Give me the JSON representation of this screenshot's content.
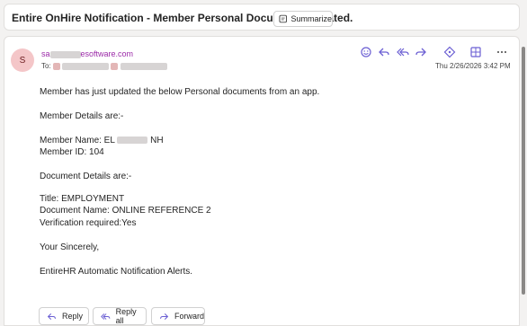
{
  "subject": "Entire OnHire Notification - Member Personal Documents updated.",
  "summarize_label": "Summarize",
  "sender": {
    "initial": "S",
    "email_prefix": "sa",
    "email_suffix": "esoftware.com"
  },
  "to_label": "To:",
  "date": "Thu 2/26/2026 3:42 PM",
  "body": {
    "intro": "Member has just updated the below Personal documents from an app.",
    "member_header": "Member Details are:-",
    "member_name_prefix": "Member Name: EL",
    "member_name_suffix": "NH",
    "member_id": "Member ID: 104",
    "doc_header": "Document Details are:-",
    "title": "Title: EMPLOYMENT",
    "doc_name": "Document Name: ONLINE REFERENCE 2",
    "verification": "Verification required:Yes",
    "closing": "Your Sincerely,",
    "signature": "EntireHR Automatic Notification Alerts."
  },
  "actions": {
    "reply": "Reply",
    "reply_all": "Reply all",
    "forward": "Forward"
  },
  "colors": {
    "icon_accent": "#6b5fd3",
    "sender_color": "#9b2aa8",
    "avatar_bg": "#f4c6c8"
  }
}
